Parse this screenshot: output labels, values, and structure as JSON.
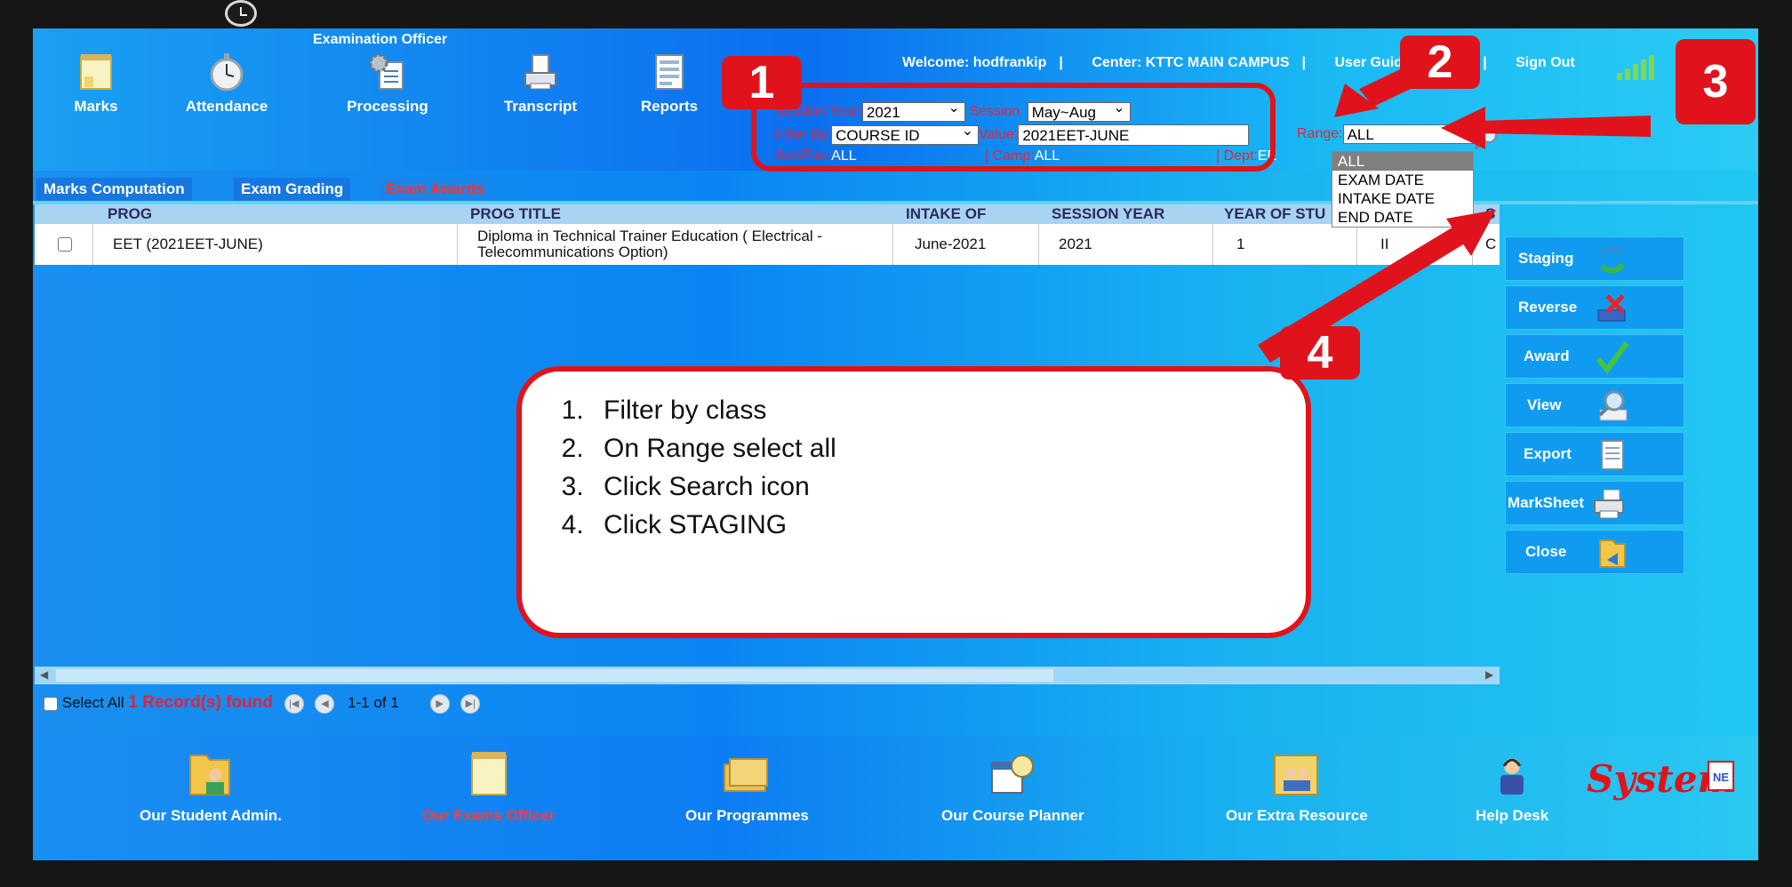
{
  "header": {
    "role_title": "Examination Officer",
    "nav": [
      {
        "label": "Marks",
        "icon": "notepad-icon"
      },
      {
        "label": "Attendance",
        "icon": "stopwatch-icon"
      },
      {
        "label": "Processing",
        "icon": "gear-document-icon"
      },
      {
        "label": "Transcript",
        "icon": "printer-document-icon"
      },
      {
        "label": "Reports",
        "icon": "report-document-icon"
      }
    ],
    "welcome": "Welcome: hodfrankip",
    "center": "Center: KTTC MAIN CAMPUS",
    "user_guide": "User Guid",
    "user_guide_tail": "t",
    "sign_out": "Sign Out"
  },
  "filters": {
    "session_year_label": "Session Year:",
    "session_year_value": "2021",
    "session_label": "Session",
    "session_value": "May~Aug",
    "filter_by_label": "Filter By:",
    "filter_by_value": "COURSE ID",
    "value_label": "Value:",
    "value_value": "2021EET-JUNE",
    "range_label": "Range:",
    "range_value": "ALL",
    "range_options": [
      "ALL",
      "EXAM DATE",
      "INTAKE DATE",
      "END DATE"
    ],
    "schfac_label": "Sch/Fac:",
    "schfac_value": "ALL",
    "camp_label": "| Camp:",
    "camp_value": "ALL",
    "dept_label": "| Dept:",
    "dept_value": "EE"
  },
  "tabs": [
    "Marks Computation",
    "Exam Grading",
    "Exam Awards"
  ],
  "table": {
    "headers": [
      "PROG",
      "PROG TITLE",
      "INTAKE OF",
      "SESSION YEAR",
      "YEAR OF STU",
      "S"
    ],
    "rows": [
      {
        "prog": "EET (2021EET-JUNE)",
        "prog_title": "Diploma in Technical Trainer Education ( Electrical - Telecommunications Option)",
        "intake_of": "June-2021",
        "session_year": "2021",
        "year_of_study": "1",
        "semester": "II",
        "extra": "C"
      }
    ]
  },
  "pager": {
    "select_all": "Select All",
    "records": "1 Record(s) found",
    "range": "1-1 of 1"
  },
  "actions": [
    {
      "label": "Staging",
      "icon": "staging-icon"
    },
    {
      "label": "Reverse",
      "icon": "reverse-icon"
    },
    {
      "label": "Award",
      "icon": "checkmark-icon"
    },
    {
      "label": "View",
      "icon": "magnifier-icon"
    },
    {
      "label": "Export",
      "icon": "export-document-icon"
    },
    {
      "label": "MarkSheet",
      "icon": "printer-icon"
    },
    {
      "label": "Close",
      "icon": "folder-exit-icon"
    }
  ],
  "footer": [
    {
      "label": "Our Student Admin.",
      "icon": "folder-user-icon"
    },
    {
      "label": "Our Exams Officer",
      "icon": "notepad-icon"
    },
    {
      "label": "Our Programmes",
      "icon": "folders-icon"
    },
    {
      "label": "Our Course Planner",
      "icon": "calendar-clock-icon"
    },
    {
      "label": "Our Extra Resource",
      "icon": "folder-users-icon"
    },
    {
      "label": "Help Desk",
      "icon": "support-person-icon"
    }
  ],
  "logo_text": "System",
  "logo_badge": "NE",
  "instructions": {
    "steps": [
      "Filter by class",
      "On Range select all",
      "Click Search icon",
      "Click STAGING"
    ],
    "badges": [
      "1",
      "2",
      "3",
      "4"
    ]
  },
  "colors": {
    "accent_red": "#e0131c",
    "tab_active": "#ff3030",
    "link_red": "#e6243a"
  }
}
